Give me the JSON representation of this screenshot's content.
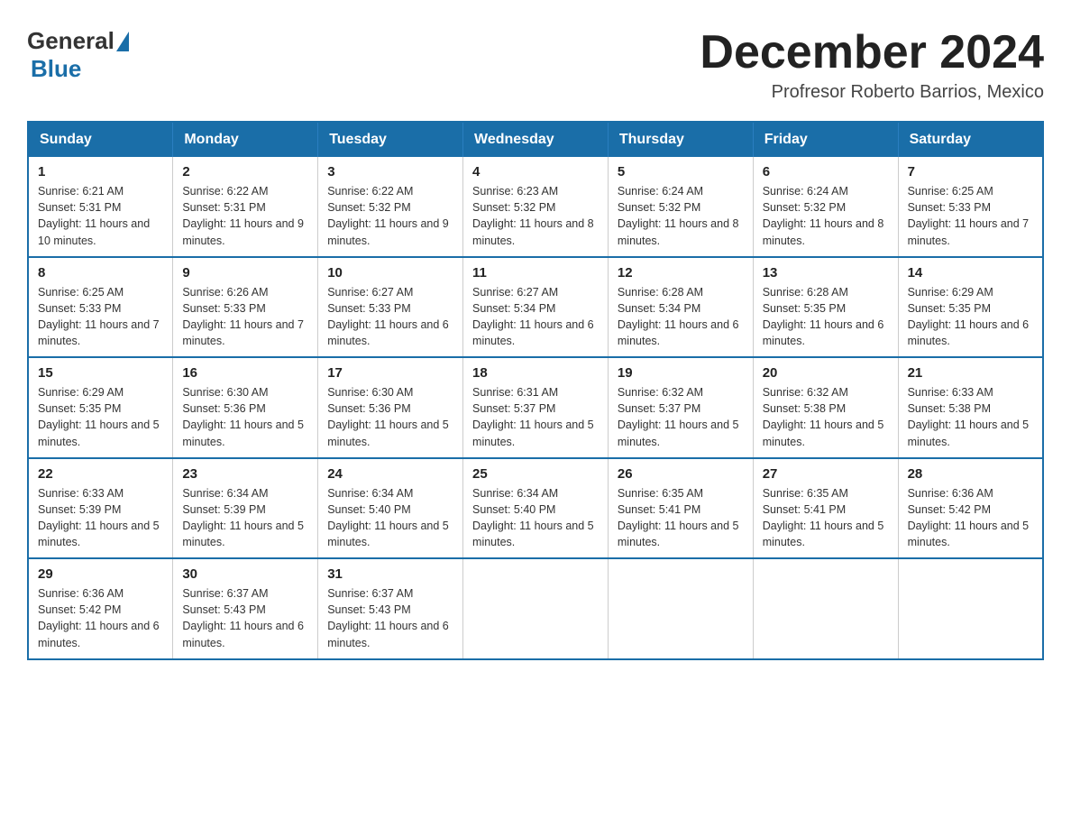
{
  "header": {
    "logo_general": "General",
    "logo_blue": "Blue",
    "month_title": "December 2024",
    "location": "Profresor Roberto Barrios, Mexico"
  },
  "days_of_week": [
    "Sunday",
    "Monday",
    "Tuesday",
    "Wednesday",
    "Thursday",
    "Friday",
    "Saturday"
  ],
  "weeks": [
    [
      {
        "day": "1",
        "sunrise": "6:21 AM",
        "sunset": "5:31 PM",
        "daylight": "11 hours and 10 minutes."
      },
      {
        "day": "2",
        "sunrise": "6:22 AM",
        "sunset": "5:31 PM",
        "daylight": "11 hours and 9 minutes."
      },
      {
        "day": "3",
        "sunrise": "6:22 AM",
        "sunset": "5:32 PM",
        "daylight": "11 hours and 9 minutes."
      },
      {
        "day": "4",
        "sunrise": "6:23 AM",
        "sunset": "5:32 PM",
        "daylight": "11 hours and 8 minutes."
      },
      {
        "day": "5",
        "sunrise": "6:24 AM",
        "sunset": "5:32 PM",
        "daylight": "11 hours and 8 minutes."
      },
      {
        "day": "6",
        "sunrise": "6:24 AM",
        "sunset": "5:32 PM",
        "daylight": "11 hours and 8 minutes."
      },
      {
        "day": "7",
        "sunrise": "6:25 AM",
        "sunset": "5:33 PM",
        "daylight": "11 hours and 7 minutes."
      }
    ],
    [
      {
        "day": "8",
        "sunrise": "6:25 AM",
        "sunset": "5:33 PM",
        "daylight": "11 hours and 7 minutes."
      },
      {
        "day": "9",
        "sunrise": "6:26 AM",
        "sunset": "5:33 PM",
        "daylight": "11 hours and 7 minutes."
      },
      {
        "day": "10",
        "sunrise": "6:27 AM",
        "sunset": "5:33 PM",
        "daylight": "11 hours and 6 minutes."
      },
      {
        "day": "11",
        "sunrise": "6:27 AM",
        "sunset": "5:34 PM",
        "daylight": "11 hours and 6 minutes."
      },
      {
        "day": "12",
        "sunrise": "6:28 AM",
        "sunset": "5:34 PM",
        "daylight": "11 hours and 6 minutes."
      },
      {
        "day": "13",
        "sunrise": "6:28 AM",
        "sunset": "5:35 PM",
        "daylight": "11 hours and 6 minutes."
      },
      {
        "day": "14",
        "sunrise": "6:29 AM",
        "sunset": "5:35 PM",
        "daylight": "11 hours and 6 minutes."
      }
    ],
    [
      {
        "day": "15",
        "sunrise": "6:29 AM",
        "sunset": "5:35 PM",
        "daylight": "11 hours and 5 minutes."
      },
      {
        "day": "16",
        "sunrise": "6:30 AM",
        "sunset": "5:36 PM",
        "daylight": "11 hours and 5 minutes."
      },
      {
        "day": "17",
        "sunrise": "6:30 AM",
        "sunset": "5:36 PM",
        "daylight": "11 hours and 5 minutes."
      },
      {
        "day": "18",
        "sunrise": "6:31 AM",
        "sunset": "5:37 PM",
        "daylight": "11 hours and 5 minutes."
      },
      {
        "day": "19",
        "sunrise": "6:32 AM",
        "sunset": "5:37 PM",
        "daylight": "11 hours and 5 minutes."
      },
      {
        "day": "20",
        "sunrise": "6:32 AM",
        "sunset": "5:38 PM",
        "daylight": "11 hours and 5 minutes."
      },
      {
        "day": "21",
        "sunrise": "6:33 AM",
        "sunset": "5:38 PM",
        "daylight": "11 hours and 5 minutes."
      }
    ],
    [
      {
        "day": "22",
        "sunrise": "6:33 AM",
        "sunset": "5:39 PM",
        "daylight": "11 hours and 5 minutes."
      },
      {
        "day": "23",
        "sunrise": "6:34 AM",
        "sunset": "5:39 PM",
        "daylight": "11 hours and 5 minutes."
      },
      {
        "day": "24",
        "sunrise": "6:34 AM",
        "sunset": "5:40 PM",
        "daylight": "11 hours and 5 minutes."
      },
      {
        "day": "25",
        "sunrise": "6:34 AM",
        "sunset": "5:40 PM",
        "daylight": "11 hours and 5 minutes."
      },
      {
        "day": "26",
        "sunrise": "6:35 AM",
        "sunset": "5:41 PM",
        "daylight": "11 hours and 5 minutes."
      },
      {
        "day": "27",
        "sunrise": "6:35 AM",
        "sunset": "5:41 PM",
        "daylight": "11 hours and 5 minutes."
      },
      {
        "day": "28",
        "sunrise": "6:36 AM",
        "sunset": "5:42 PM",
        "daylight": "11 hours and 5 minutes."
      }
    ],
    [
      {
        "day": "29",
        "sunrise": "6:36 AM",
        "sunset": "5:42 PM",
        "daylight": "11 hours and 6 minutes."
      },
      {
        "day": "30",
        "sunrise": "6:37 AM",
        "sunset": "5:43 PM",
        "daylight": "11 hours and 6 minutes."
      },
      {
        "day": "31",
        "sunrise": "6:37 AM",
        "sunset": "5:43 PM",
        "daylight": "11 hours and 6 minutes."
      },
      null,
      null,
      null,
      null
    ]
  ]
}
